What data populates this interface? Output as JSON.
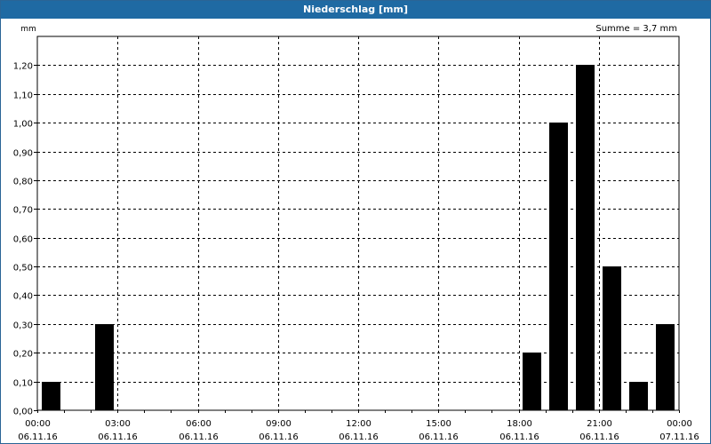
{
  "window": {
    "title": "Niederschlag [mm]"
  },
  "chart_data": {
    "type": "bar",
    "title": "Niederschlag [mm]",
    "summary": "Summe = 3,7 mm",
    "ylabel": "mm",
    "ylim": [
      0,
      1.3
    ],
    "yticks": [
      "0,00",
      "0,10",
      "0,20",
      "0,30",
      "0,40",
      "0,50",
      "0,60",
      "0,70",
      "0,80",
      "0,90",
      "1,00",
      "1,10",
      "1,20"
    ],
    "xlim_hours": [
      0,
      24
    ],
    "xticks": [
      {
        "hour": 0,
        "time": "00:00",
        "date": "06.11.16"
      },
      {
        "hour": 3,
        "time": "03:00",
        "date": "06.11.16"
      },
      {
        "hour": 6,
        "time": "06:00",
        "date": "06.11.16"
      },
      {
        "hour": 9,
        "time": "09:00",
        "date": "06.11.16"
      },
      {
        "hour": 12,
        "time": "12:00",
        "date": "06.11.16"
      },
      {
        "hour": 15,
        "time": "15:00",
        "date": "06.11.16"
      },
      {
        "hour": 18,
        "time": "18:00",
        "date": "06.11.16"
      },
      {
        "hour": 21,
        "time": "21:00",
        "date": "06.11.16"
      },
      {
        "hour": 24,
        "time": "00:00",
        "date": "07.11.16"
      }
    ],
    "bars": [
      {
        "hour": 0,
        "value": 0.1
      },
      {
        "hour": 2,
        "value": 0.3
      },
      {
        "hour": 18,
        "value": 0.2
      },
      {
        "hour": 19,
        "value": 1.0
      },
      {
        "hour": 20,
        "value": 1.2
      },
      {
        "hour": 21,
        "value": 0.5
      },
      {
        "hour": 22,
        "value": 0.1
      },
      {
        "hour": 23,
        "value": 0.3
      }
    ],
    "bar_color": "#000000",
    "grid": true
  }
}
